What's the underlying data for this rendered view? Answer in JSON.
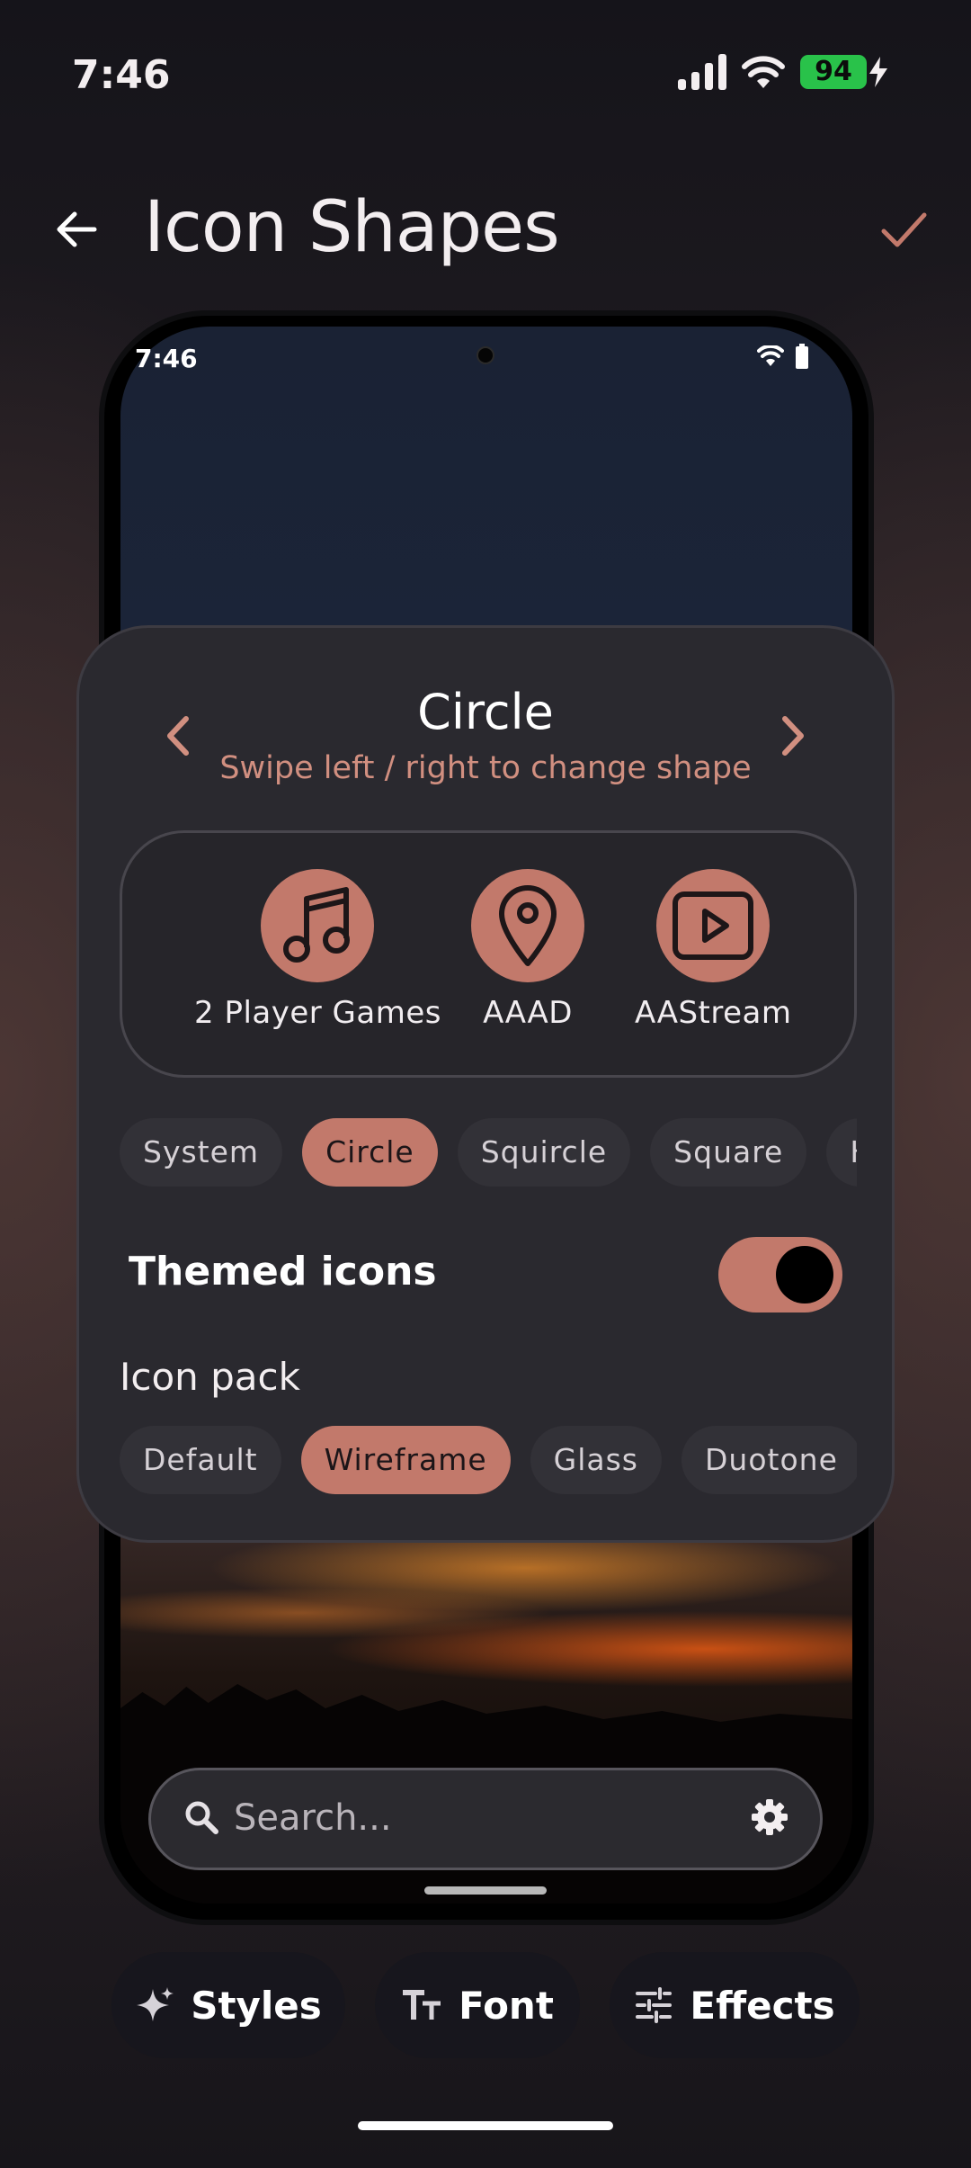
{
  "status_bar": {
    "time": "7:46",
    "battery_level": "94"
  },
  "header": {
    "title": "Icon Shapes"
  },
  "preview": {
    "time": "7:46",
    "search_placeholder": "Search..."
  },
  "card": {
    "shape_name": "Circle",
    "hint": "Swipe left / right to change shape",
    "apps": [
      {
        "label": "2 Player Games",
        "icon": "music-note-icon"
      },
      {
        "label": "AAAD",
        "icon": "location-pin-icon"
      },
      {
        "label": "AAStream",
        "icon": "play-box-icon"
      }
    ],
    "shapes": [
      "System",
      "Circle",
      "Squircle",
      "Square",
      "He"
    ],
    "selected_shape": "Circle",
    "themed_icons_label": "Themed icons",
    "themed_icons_enabled": true,
    "icon_pack_label": "Icon pack",
    "icon_packs": [
      "Default",
      "Wireframe",
      "Glass",
      "Duotone"
    ],
    "selected_icon_pack": "Wireframe"
  },
  "actions": {
    "styles": "Styles",
    "font": "Font",
    "effects": "Effects"
  },
  "colors": {
    "accent": "#c2796b",
    "hint_text": "#d18f80",
    "card_background": "#2a292f",
    "battery_green": "#29c24a"
  }
}
